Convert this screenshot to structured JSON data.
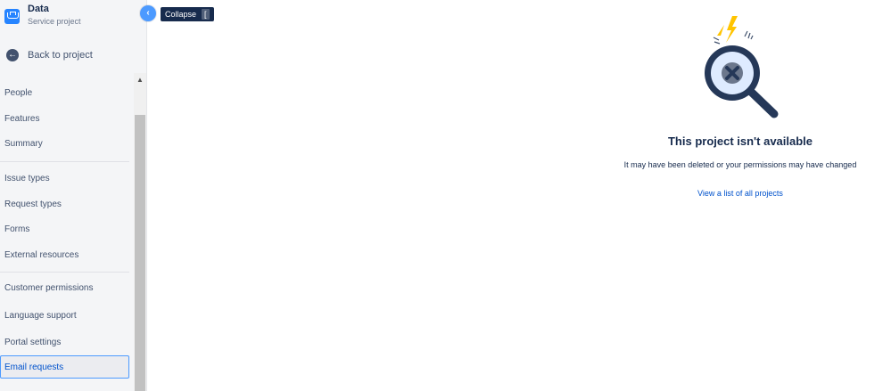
{
  "project": {
    "name": "Data",
    "type": "Service project",
    "icon": "project-icon"
  },
  "back": {
    "label": "Back to project",
    "icon": "arrow-left-icon"
  },
  "collapse": {
    "tooltip": "Collapse",
    "shortcut": "[",
    "icon": "chevron-left-icon"
  },
  "nav": {
    "items": [
      {
        "label": "People"
      },
      {
        "label": "Features"
      },
      {
        "label": "Summary"
      },
      {
        "label": "Issue types"
      },
      {
        "label": "Request types"
      },
      {
        "label": "Forms"
      },
      {
        "label": "External resources"
      },
      {
        "label": "Customer permissions"
      },
      {
        "label": "Language support"
      },
      {
        "label": "Portal settings"
      },
      {
        "label": "Email requests"
      }
    ],
    "active": "Email requests"
  },
  "empty_state": {
    "title": "This project isn't available",
    "description": "It may have been deleted or your permissions may have changed",
    "link": "View a list of all projects",
    "illustration": "magnifying-glass-icon"
  },
  "colors": {
    "accent": "#4c9aff",
    "link": "#0052cc",
    "text": "#172b4d",
    "sidebar_bg": "#f4f5f7"
  }
}
